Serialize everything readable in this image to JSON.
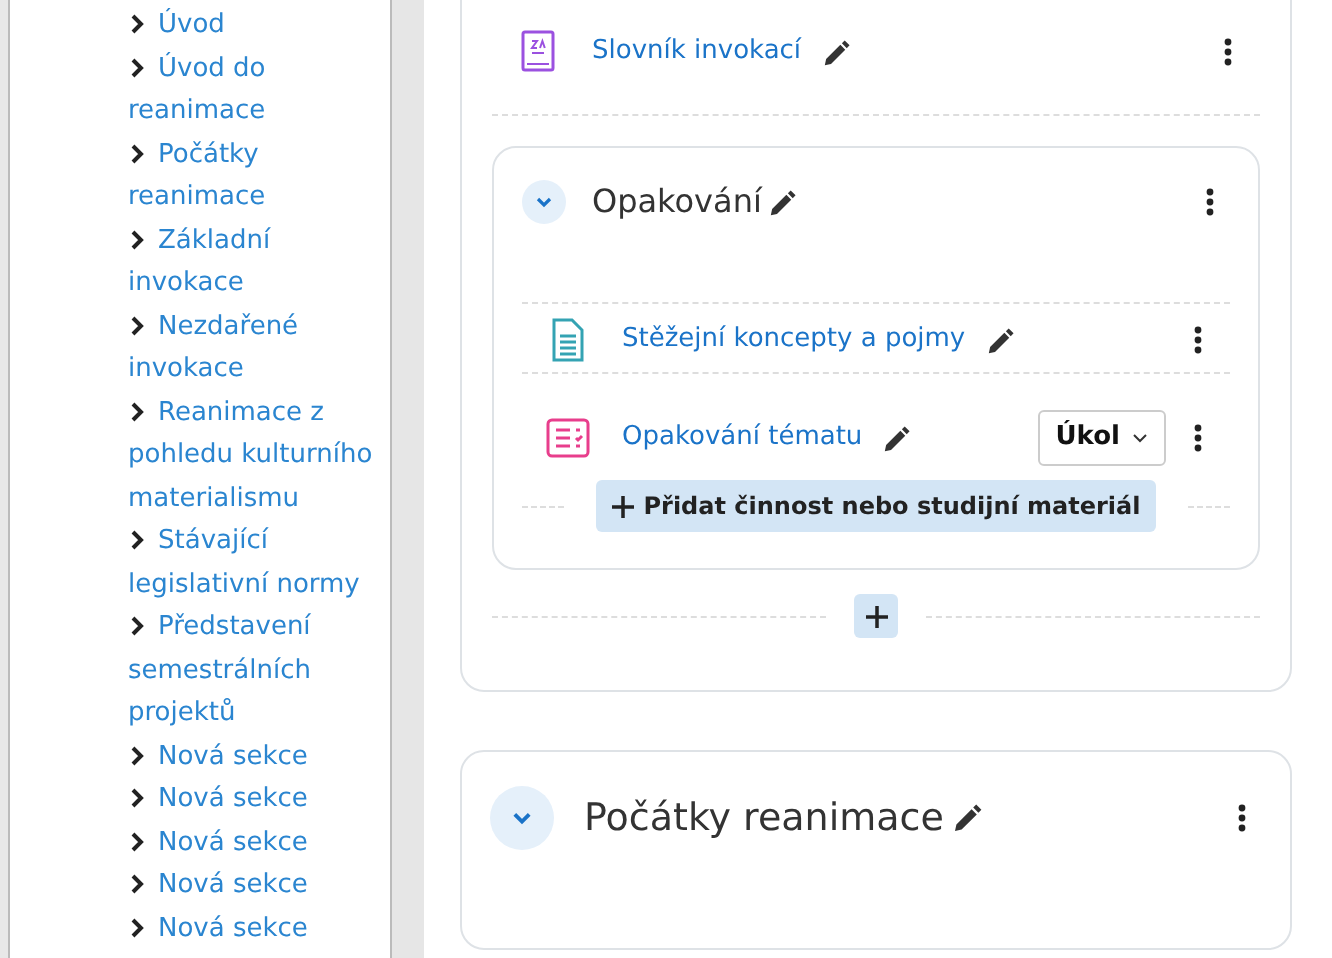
{
  "sidebar": {
    "items": [
      {
        "label": "Úvod"
      },
      {
        "label": "Úvod do reanimace"
      },
      {
        "label": "Počátky reanimace"
      },
      {
        "label": "Základní invokace"
      },
      {
        "label": "Nezdařené invokace"
      },
      {
        "label": "Reanimace z pohledu kulturního materialismu"
      },
      {
        "label": "Stávající legislativní normy"
      },
      {
        "label": "Představení semestrálních projektů"
      },
      {
        "label": "Nová sekce"
      },
      {
        "label": "Nová sekce"
      },
      {
        "label": "Nová sekce"
      },
      {
        "label": "Nová sekce"
      },
      {
        "label": "Nová sekce"
      }
    ]
  },
  "top_section": {
    "activities": [
      {
        "kind": "glossary",
        "title": "Slovník invokací"
      }
    ],
    "subsection": {
      "title": "Opakování",
      "expanded": true,
      "activities": [
        {
          "kind": "page",
          "title": "Stěžejní koncepty a pojmy"
        },
        {
          "kind": "assignment",
          "title": "Opakování tématu",
          "type_select": "Úkol"
        }
      ],
      "add_button": "Přidat činnost nebo studijní materiál"
    }
  },
  "next_section": {
    "title": "Počátky reanimace",
    "expanded": true
  }
}
